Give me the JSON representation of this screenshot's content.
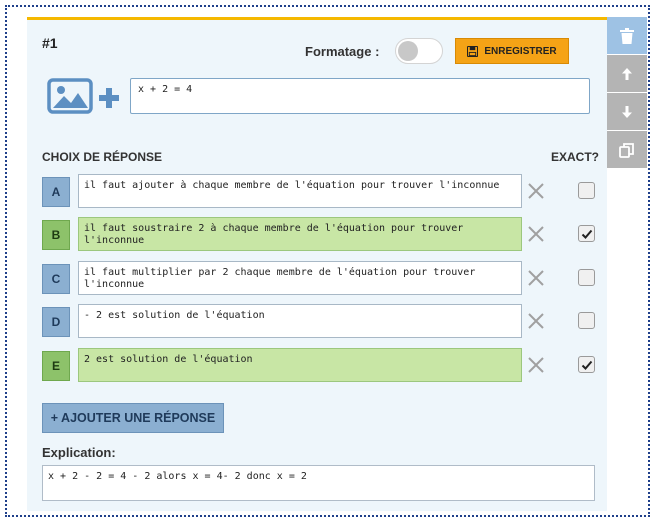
{
  "question": {
    "number": "#1",
    "format_label": "Formatage :",
    "save_label": "ENREGISTRER",
    "text": "x + 2 = 4"
  },
  "answers": {
    "section_title": "CHOIX DE RÉPONSE",
    "exact_title": "EXACT?",
    "items": [
      {
        "letter": "A",
        "text": "il faut ajouter à chaque membre de l'équation pour trouver l'inconnue",
        "correct": false
      },
      {
        "letter": "B",
        "text": "il faut soustraire 2 à chaque membre de l'équation pour trouver l'inconnue",
        "correct": true
      },
      {
        "letter": "C",
        "text": "il faut multiplier par 2 chaque membre de l'équation pour trouver l'inconnue",
        "correct": false
      },
      {
        "letter": "D",
        "text": "- 2 est solution de l'équation",
        "correct": false
      },
      {
        "letter": "E",
        "text": "2 est solution de l'équation",
        "correct": true
      }
    ],
    "add_label": "+ AJOUTER UNE RÉPONSE"
  },
  "explanation": {
    "label": "Explication:",
    "text": "x + 2 - 2 = 4 - 2 alors x = 4- 2 donc x = 2"
  },
  "sidebar": {
    "icons": [
      "trash-icon",
      "arrow-up-icon",
      "arrow-down-icon",
      "duplicate-icon"
    ]
  },
  "colors": {
    "accent": "#f5b800",
    "save_button": "#f5a316",
    "letter_default": "#8bafd1",
    "letter_correct": "#8dc26a",
    "answer_correct_bg": "#c8e6a5"
  }
}
